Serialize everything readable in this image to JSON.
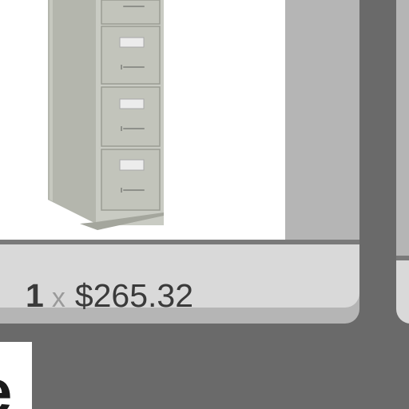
{
  "product_card": {
    "image_icon": "filing-cabinet-icon",
    "quantity": "1",
    "times_symbol": "x",
    "price": "$265.32"
  },
  "next_card_below": {
    "title_fragment": "e"
  },
  "colors": {
    "background": "#6a6a6a",
    "card_panel": "#b5b5b5",
    "price_bar": "#d9d9d9",
    "price_text": "#3a3a3a",
    "multiply_sign": "#9a9a9a"
  }
}
